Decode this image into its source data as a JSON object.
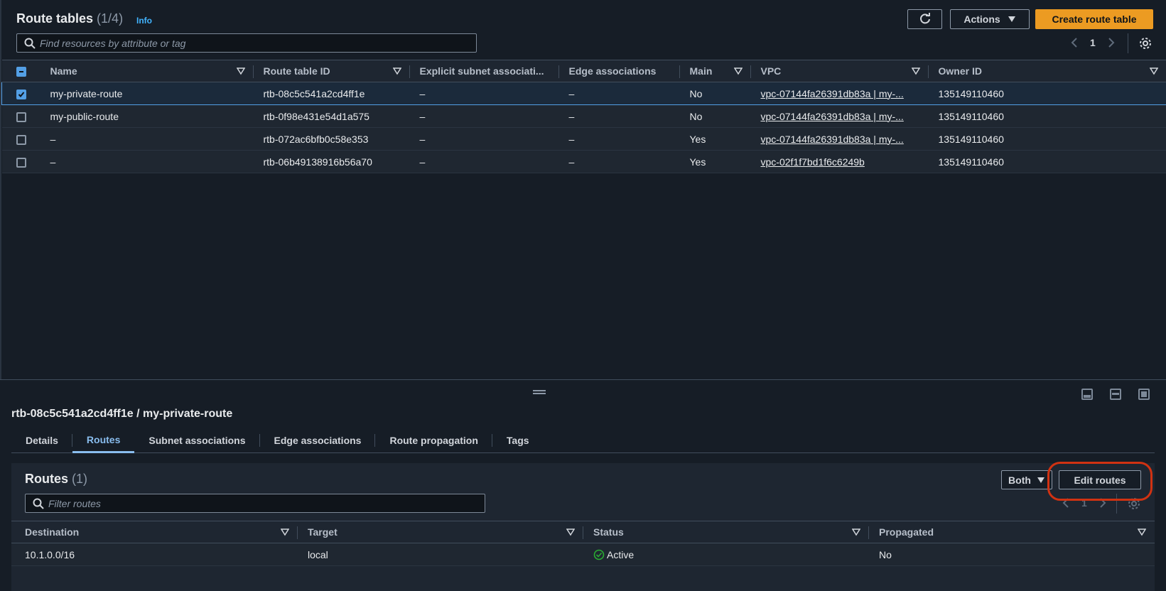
{
  "header": {
    "title": "Route tables",
    "count": "(1/4)",
    "info": "Info",
    "actions_label": "Actions",
    "create_label": "Create route table",
    "search_placeholder": "Find resources by attribute or tag",
    "page": "1"
  },
  "table": {
    "columns": [
      "Name",
      "Route table ID",
      "Explicit subnet associati...",
      "Edge associations",
      "Main",
      "VPC",
      "Owner ID"
    ],
    "rows": [
      {
        "name": "my-private-route",
        "id": "rtb-08c5c541a2cd4ff1e",
        "subnet": "–",
        "edge": "–",
        "main": "No",
        "vpc": "vpc-07144fa26391db83a | my-...",
        "owner": "135149110460",
        "checked": true
      },
      {
        "name": "my-public-route",
        "id": "rtb-0f98e431e54d1a575",
        "subnet": "–",
        "edge": "–",
        "main": "No",
        "vpc": "vpc-07144fa26391db83a | my-...",
        "owner": "135149110460",
        "checked": false
      },
      {
        "name": "–",
        "id": "rtb-072ac6bfb0c58e353",
        "subnet": "–",
        "edge": "–",
        "main": "Yes",
        "vpc": "vpc-07144fa26391db83a | my-...",
        "owner": "135149110460",
        "checked": false
      },
      {
        "name": "–",
        "id": "rtb-06b49138916b56a70",
        "subnet": "–",
        "edge": "–",
        "main": "Yes",
        "vpc": "vpc-02f1f7bd1f6c6249b",
        "owner": "135149110460",
        "checked": false
      }
    ]
  },
  "detail": {
    "title": "rtb-08c5c541a2cd4ff1e / my-private-route",
    "tabs": [
      "Details",
      "Routes",
      "Subnet associations",
      "Edge associations",
      "Route propagation",
      "Tags"
    ],
    "active_tab": "Routes"
  },
  "routes": {
    "title": "Routes",
    "count": "(1)",
    "filter_label": "Both",
    "edit_label": "Edit routes",
    "search_placeholder": "Filter routes",
    "page": "1",
    "columns": [
      "Destination",
      "Target",
      "Status",
      "Propagated"
    ],
    "rows": [
      {
        "destination": "10.1.0.0/16",
        "target": "local",
        "status": "Active",
        "propagated": "No"
      }
    ]
  },
  "colors": {
    "primary_button": "#ec9b22",
    "link": "#5eb7f5",
    "active_status": "#29ad32",
    "highlight_ring": "#d13212"
  }
}
